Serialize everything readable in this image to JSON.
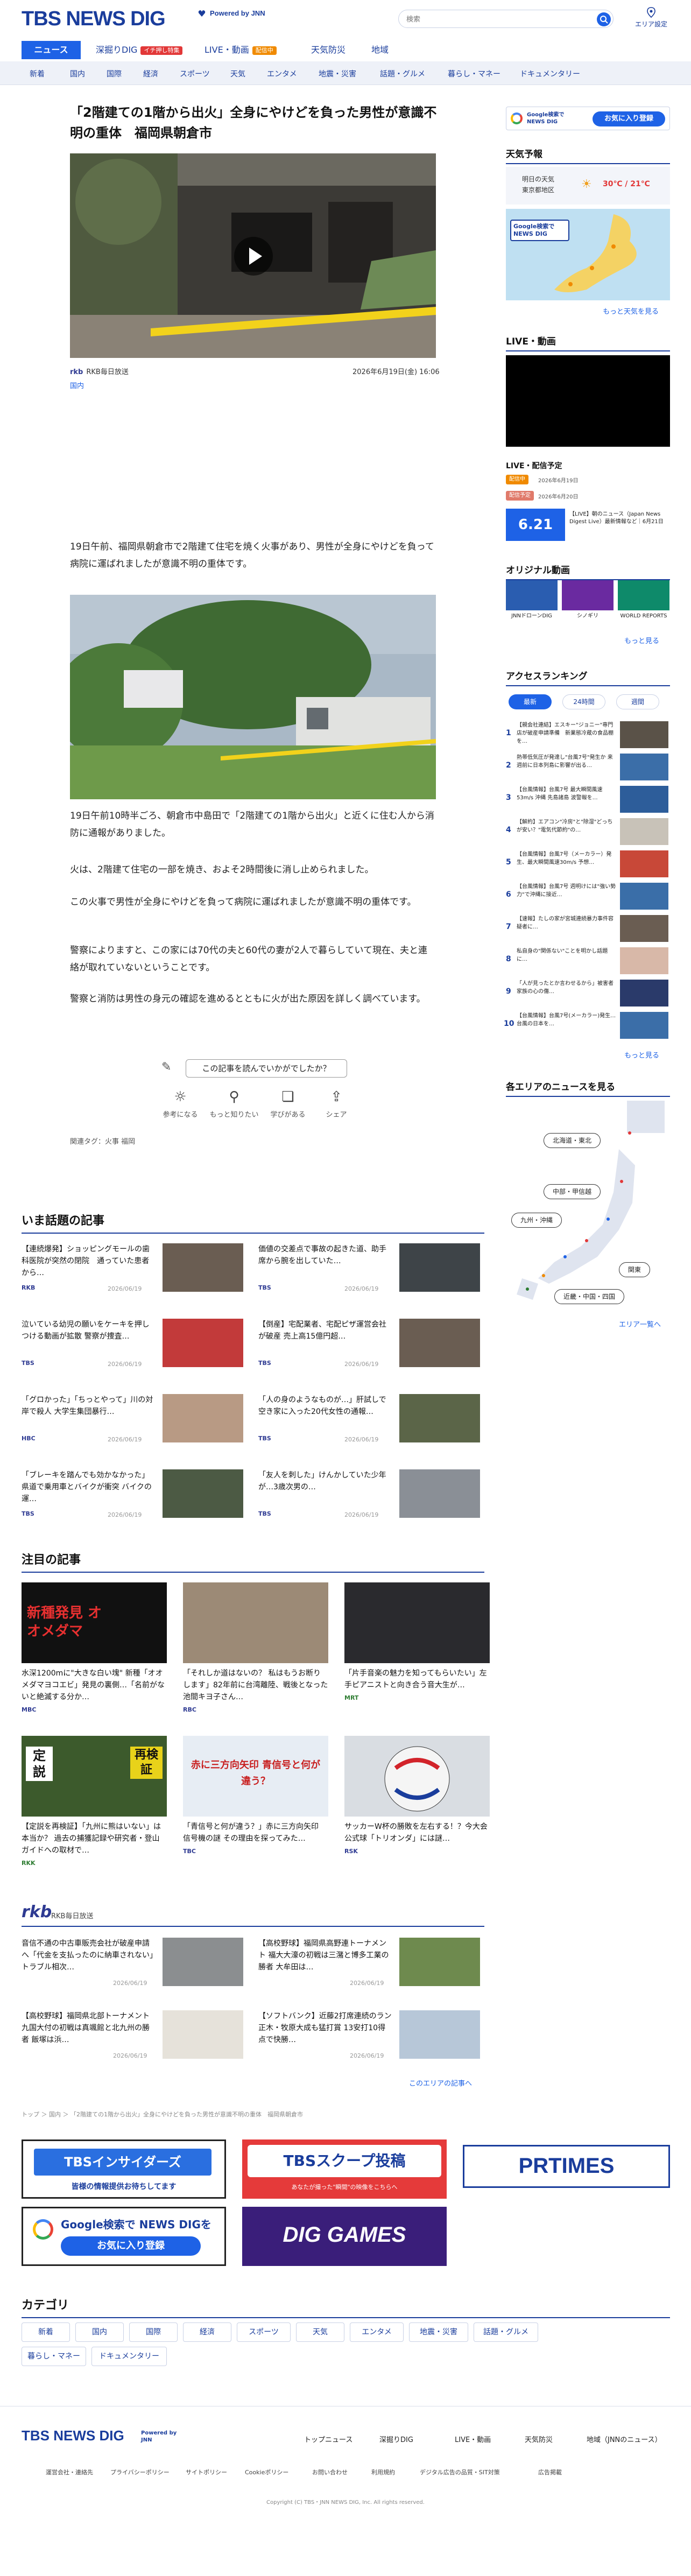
{
  "header": {
    "logo": "TBS NEWS DIG",
    "powered_by": "Powered by JNN",
    "search_placeholder": "検索",
    "area_setting": "エリア設定"
  },
  "nav_primary": {
    "news": "ニュース",
    "fukabori": "深掘りDIG",
    "fukabori_badge": "イチ押し特集",
    "live": "LIVE・動画",
    "live_badge": "配信中",
    "weather": "天気防災",
    "area": "地域"
  },
  "nav_categories": [
    "新着",
    "国内",
    "国際",
    "経済",
    "スポーツ",
    "天気",
    "エンタメ",
    "地震・災害",
    "話題・グルメ",
    "暮らし・マネー",
    "ドキュメンタリー"
  ],
  "article": {
    "title": "「2階建ての1階から出火」全身にやけどを負った男性が意識不明の重体　福岡県朝倉市",
    "video_caption_overlay": "",
    "source": "RKB毎日放送",
    "date": "2026年6月19日(金) 16:06",
    "category": "国内",
    "paragraphs": [
      "19日午前、福岡県朝倉市で2階建て住宅を焼く火事があり、男性が全身にやけどを負って病院に運ばれましたが意識不明の重体です。",
      "19日午前10時半ごろ、朝倉市中島田で「2階建ての1階から出火」と近くに住む人から消防に通報がありました。",
      "火は、2階建て住宅の一部を焼き、およそ2時間後に消し止められました。",
      "この火事で男性が全身にやけどを負って病院に運ばれましたが意識不明の重体です。",
      "警察によりますと、この家には70代の夫と60代の妻が2人で暮らしていて現在、夫と連絡が取れていないということです。",
      "警察と消防は男性の身元の確認を進めるとともに火が出た原因を詳しく調べています。"
    ],
    "feedback_question": "この記事を読んでいかがでしたか？",
    "feedback_options": [
      "参考になる",
      "もっと知りたい",
      "学びがある",
      "シェア"
    ],
    "tags_label": "関連タグ：火事 福岡"
  },
  "sidebar": {
    "google_pref": "Google検索で NEWS DIG",
    "google_pref_button": "お気に入り登録",
    "weather_title": "天気予報",
    "weather_day": "明日の天気",
    "weather_region": "東京都地区",
    "weather_temp": "30℃ / 21℃",
    "weather_more": "もっと天気を見る",
    "live_title": "LIVE・動画",
    "live_schedule_title": "LIVE・配信予定",
    "live_items": [
      {
        "badge": "配信中",
        "date": "2026年6月19日"
      },
      {
        "badge": "配信予定",
        "date": "2026年6月20日"
      }
    ],
    "live_feature": "【LIVE】朝のニュース（Japan News Digest Live）最新情報など｜6月21日",
    "live_feature_badge": "6.21",
    "original_title": "オリジナル動画",
    "original_items": [
      "JNNドローンDIG",
      "シノギリ",
      "WORLD REPORTS"
    ],
    "weather_more2": "もっと見る",
    "ranking_title": "アクセスランキング",
    "ranking_tabs": [
      "最新",
      "24時間",
      "週間"
    ],
    "ranking_items": [
      "【親会社連結】エスキー\"ジョニー\"専門店が破産申請準備　新業態冷蔵の食品棚を…",
      "熱帯低気圧が発達し\"台風7号\"発生か 来週前に日本列島に影響が出る…",
      "【台風情報】台風7号 最大瞬間風速53m/s 沖縄 先島諸島 波警報を…",
      "【解約】エアコン\"冷房\"と\"除湿\"どっちが安い？\"電気代節約\"の…",
      "【台風情報】台風7号（メーカラー）発生、最大瞬間風速30m/s 予想…",
      "【台風情報】台風7号 週明けには\"強い勢力\"で沖縄に接近…",
      "【速報】たしの家が宮城連続暴力事件容疑者に…",
      "私自身の\"関係ない\"ことを明かし話題に…",
      "「人が見ったとか言わせるから」被害者家族の心の傷…",
      "【台風情報】台風7号(メーカラー)発生…台風の日本を…"
    ],
    "ranking_more": "もっと見る",
    "area_title": "各エリアのニュースを見る",
    "area_buttons": [
      "北海道・東北",
      "中部・甲信越",
      "九州・沖縄",
      "関東",
      "近畿・中国・四国"
    ],
    "area_more": "エリア一覧へ"
  },
  "topics": {
    "title": "いま話題の記事",
    "items": [
      {
        "title": "【連続爆発】ショッピングモールの歯科医院が突然の閉院　通っていた患者から…",
        "src": "RKB",
        "date": "2026/06/19"
      },
      {
        "title": "価値の交差点で事故の起きた道、助手席から腕を出していた…",
        "src": "TBS",
        "date": "2026/06/19"
      },
      {
        "title": "泣いている幼児の願いをケーキを押しつける動画が拡散 警察が捜査…",
        "src": "TBS",
        "date": "2026/06/19"
      },
      {
        "title": "【倒産】宅配業者、宅配ピザ運営会社が破産 売上高15億円超…",
        "src": "TBS",
        "date": "2026/06/19"
      },
      {
        "title": "「グロかった」「ちっとやって」川の対岸で殺人 大学生集団暴行…",
        "src": "HBC",
        "date": "2026/06/19"
      },
      {
        "title": "「人の身のようなものが…」肝試しで空き家に入った20代女性の通報…",
        "src": "TBS",
        "date": "2026/06/19"
      },
      {
        "title": "「ブレーキを踏んでも効かなかった」県道で乗用車とバイクが衝突 バイクの運…",
        "src": "TBS",
        "date": "2026/06/19"
      },
      {
        "title": "「友人を刺した」けんかしていた少年が…3歳次男の…",
        "src": "TBS",
        "date": "2026/06/19"
      }
    ]
  },
  "featured": {
    "title": "注目の記事",
    "items": [
      {
        "title": "水深1200mに\"大きな白い塊\" 新種「オオメダマヨコエビ」発見の裏側…「名前がないと絶滅する分か…",
        "src": "MBC",
        "date": "2026/06/19",
        "img_text": "新種発見 オオメダマ"
      },
      {
        "title": "「それしか道はないの？ 私はもうお断りします」82年前に台湾離陸、戦後となった池間キヨ子さん…",
        "src": "RBC",
        "date": "2026/06/19"
      },
      {
        "title": "「片手音楽の魅力を知ってもらいたい」左手ピアニストと向き合う音大生が…",
        "src": "MRT",
        "date": "2026/06/19"
      },
      {
        "title": "【定説を再検証】「九州に熊はいない」は本当か？ 過去の捕獲記録や研究者・登山ガイドへの取材で…",
        "src": "RKK",
        "date": "2026/06/19",
        "img_text_a": "定説",
        "img_text_b": "再検証"
      },
      {
        "title": "「青信号と何が違う？」赤に三方向矢印 信号機の謎 その理由を探ってみた…",
        "src": "TBC",
        "date": "2026/06/19",
        "img_text": "赤に三方向矢印 青信号と何が違う？"
      },
      {
        "title": "サッカーW杯の勝敗を左右する！？今大会公式球「トリオンダ」には謎…",
        "src": "RSK",
        "date": "2026/06/19"
      }
    ]
  },
  "rkb": {
    "logo": "rkb",
    "label": "RKB毎日放送",
    "items": [
      {
        "title": "音信不通の中古車販売会社が破産申請へ「代金を支払ったのに納車されない」トラブル相次…",
        "date": "2026/06/19"
      },
      {
        "title": "【高校野球】福岡県高野連トーナメント 福大大濠の初戦は三潴と博多工業の勝者 大牟田は…",
        "date": "2026/06/19"
      },
      {
        "title": "【高校野球】福岡県北部トーナメント 九国大付の初戦は真颯館と北九州の勝者 飯塚は浜…",
        "date": "2026/06/19"
      },
      {
        "title": "【ソフトバンク】近藤2打席連続のラン 正木・牧原大成も猛打賞 13安打10得点で快勝…",
        "date": "2026/06/19"
      }
    ],
    "more": "このエリアの記事へ"
  },
  "breadcrumb": "トップ ＞ 国内 ＞ 「2階建ての1階から出火」全身にやけどを負った男性が意識不明の重体　福岡県朝倉市",
  "banners": {
    "insider": "TBSインサイダーズ",
    "insider_sub": "皆様の情報提供お待ちしてます",
    "scoop": "TBSスクープ投稿",
    "scoop_sub": "あなたが撮った\"瞬間\"の映像をこちらへ",
    "prtimes": "PRTIMES",
    "google": "Google検索で NEWS DIGを",
    "google_btn": "お気に入り登録",
    "games": "DIG GAMES"
  },
  "categories": {
    "title": "カテゴリ",
    "items": [
      "新着",
      "国内",
      "国際",
      "経済",
      "スポーツ",
      "天気",
      "エンタメ",
      "地震・災害",
      "話題・グルメ",
      "暮らし・マネー",
      "ドキュメンタリー"
    ]
  },
  "footer": {
    "logo": "TBS NEWS DIG",
    "powered_by": "Powered by JNN",
    "links": [
      "トップニュース",
      "深掘りDIG",
      "LIVE・動画",
      "天気防災",
      "地域（JNNのニュース）"
    ],
    "sub_links": [
      "運営会社・連絡先",
      "プライバシーポリシー",
      "サイトポリシー",
      "Cookieポリシー",
      "お問い合わせ",
      "利用規約",
      "デジタル広告の品質・SIT対策",
      "広告掲載"
    ],
    "copyright": "Copyright (C) TBS・JNN NEWS DIG, Inc. All rights reserved."
  },
  "colors": {
    "brand": "#1a3d9c",
    "accent": "#1e62e6",
    "alert": "#e23838"
  }
}
